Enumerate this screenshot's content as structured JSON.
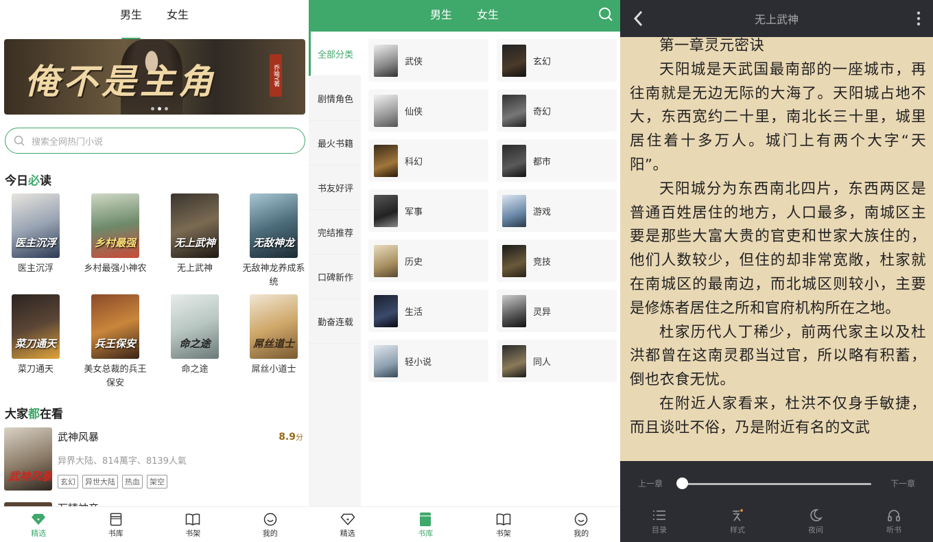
{
  "panel1": {
    "tabs": [
      "男生",
      "女生"
    ],
    "banner": {
      "title": "俺不是主角",
      "seal": "乔喻Y著"
    },
    "search_placeholder": "搜索全网热门小说",
    "section_today": {
      "prefix": "今日",
      "highlight": "必",
      "suffix": "读"
    },
    "books": [
      {
        "name": "医主沉浮",
        "cover_text": "医主沉浮"
      },
      {
        "name": "乡村最强小神农",
        "cover_text": "乡村最强"
      },
      {
        "name": "无上武神",
        "cover_text": "无上武神"
      },
      {
        "name": "无敌神龙养成系统",
        "cover_text": "无敌神龙"
      },
      {
        "name": "菜刀通天",
        "cover_text": "菜刀通天"
      },
      {
        "name": "美女总裁的兵王保安",
        "cover_text": "兵王保安"
      },
      {
        "name": "命之途",
        "cover_text": "命之途"
      },
      {
        "name": "屌丝小道士",
        "cover_text": "屌丝道士"
      }
    ],
    "section_all": {
      "prefix": "大家",
      "highlight": "都",
      "suffix": "在看"
    },
    "featured": {
      "title": "武神风暴",
      "score": "8.9",
      "score_unit": "分",
      "meta": "异界大陆、814萬字、8139人氣",
      "tags": [
        "玄幻",
        "异世大陆",
        "热血",
        "架空"
      ],
      "cover_text": "武神风暴"
    },
    "next_title": "万精神帝",
    "nav": [
      {
        "label": "精选",
        "icon": "gem-icon",
        "active": true
      },
      {
        "label": "书库",
        "icon": "library-icon",
        "active": false
      },
      {
        "label": "书架",
        "icon": "bookshelf-icon",
        "active": false
      },
      {
        "label": "我的",
        "icon": "smile-icon",
        "active": false
      }
    ]
  },
  "panel2": {
    "tabs": [
      "男生",
      "女生"
    ],
    "categories": [
      "全部分类",
      "剧情角色",
      "最火书籍",
      "书友好评",
      "完结推荐",
      "口碑新作",
      "勤奋连载"
    ],
    "genres": [
      "武侠",
      "玄幻",
      "仙侠",
      "奇幻",
      "科幻",
      "都市",
      "军事",
      "游戏",
      "历史",
      "竞技",
      "生活",
      "灵异",
      "轻小说",
      "同人"
    ],
    "nav": [
      {
        "label": "精选",
        "icon": "gem-icon",
        "active": false
      },
      {
        "label": "书库",
        "icon": "library-icon",
        "active": true
      },
      {
        "label": "书架",
        "icon": "bookshelf-icon",
        "active": false
      },
      {
        "label": "我的",
        "icon": "smile-icon",
        "active": false
      }
    ]
  },
  "panel3": {
    "title": "无上武神",
    "chapter": "第一章灵元密诀",
    "paragraphs": [
      "天阳城是天武国最南部的一座城市，再往南就是无边无际的大海了。天阳城占地不大，东西宽约二十里，南北长三十里，城里居住着十多万人。城门上有两个大字“天阳”。",
      "天阳城分为东西南北四片，东西两区是普通百姓居住的地方，人口最多，南城区主要是那些大富大贵的官吏和世家大族住的，他们人数较少，但住的却非常宽敞，杜家就在南城区的最南边，而北城区则较小，主要是修炼者居住之所和官府机构所在之地。",
      "杜家历代人丁稀少，前两代家主以及杜洪都曾在这南灵郡当过官，所以略有积蓄，倒也衣食无忧。",
      "在附近人家看来，杜洪不仅身手敏捷，而且谈吐不俗，乃是附近有名的文武"
    ],
    "prev_label": "上一章",
    "next_label": "下一章",
    "progress": 0,
    "nav": [
      {
        "label": "目录",
        "icon": "list-icon"
      },
      {
        "label": "样式",
        "icon": "text-style-icon"
      },
      {
        "label": "夜间",
        "icon": "moon-icon"
      },
      {
        "label": "听书",
        "icon": "headphones-icon"
      }
    ]
  },
  "colors": {
    "accent": "#3fa86b",
    "reader_bg": "#e9d8b4",
    "reader_bar": "#2b2d33"
  }
}
